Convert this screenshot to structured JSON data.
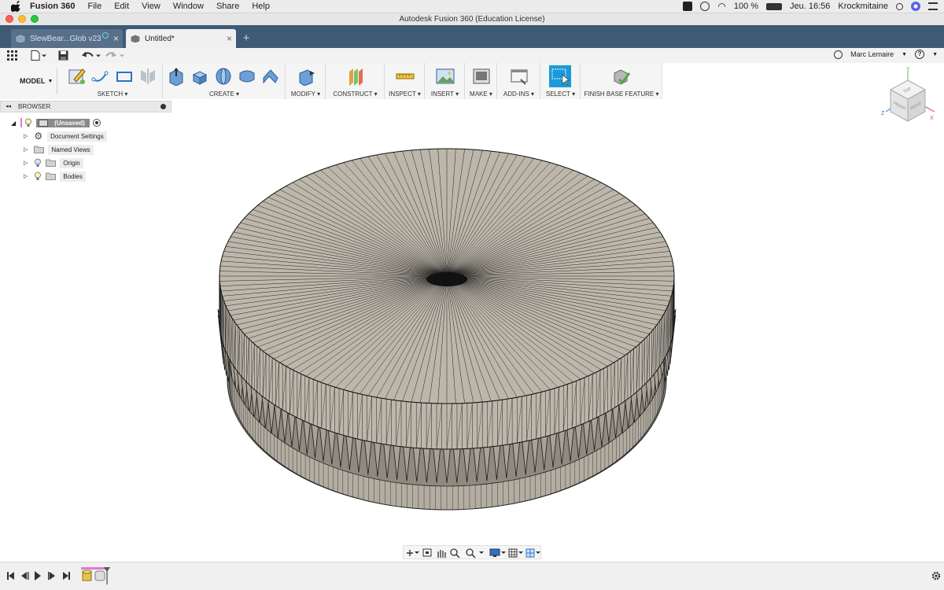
{
  "menubar": {
    "app_name": "Fusion 360",
    "items": [
      "File",
      "Edit",
      "View",
      "Window",
      "Share",
      "Help"
    ],
    "battery": "100 %",
    "clock": "Jeu. 16:56",
    "user": "Krockmitaine"
  },
  "window": {
    "title": "Autodesk Fusion 360 (Education License)"
  },
  "tabs": [
    {
      "label": "SlewBear...Glob v23",
      "state": "inactive"
    },
    {
      "label": "Untitled*",
      "state": "active"
    }
  ],
  "quickbar": {
    "user_name": "Marc Lemaire"
  },
  "ribbon": {
    "workspace": "MODEL",
    "groups": [
      "SKETCH",
      "CREATE",
      "MODIFY",
      "CONSTRUCT",
      "INSPECT",
      "INSERT",
      "MAKE",
      "ADD-INS",
      "SELECT",
      "FINISH BASE FEATURE"
    ]
  },
  "browser": {
    "title": "BROWSER",
    "root": "(Unsaved)",
    "items": [
      "Document Settings",
      "Named Views",
      "Origin",
      "Bodies"
    ]
  },
  "viewcube": {
    "faces": [
      "TOP",
      "FRONT",
      "RIGHT"
    ],
    "axes": [
      "Y",
      "Z",
      "X"
    ]
  },
  "colors": {
    "tabbar": "#3e5a75",
    "model": "#bdb7ab",
    "select_active": "#1a9ad8",
    "accent_pink": "#e07ad0"
  },
  "icons": [
    "apple-icon",
    "grid-icon",
    "file-icon",
    "save-icon",
    "undo-icon",
    "redo-icon",
    "clock-icon",
    "help-icon",
    "lightbulb-icon",
    "gear-icon",
    "folder-icon",
    "play-icon"
  ]
}
